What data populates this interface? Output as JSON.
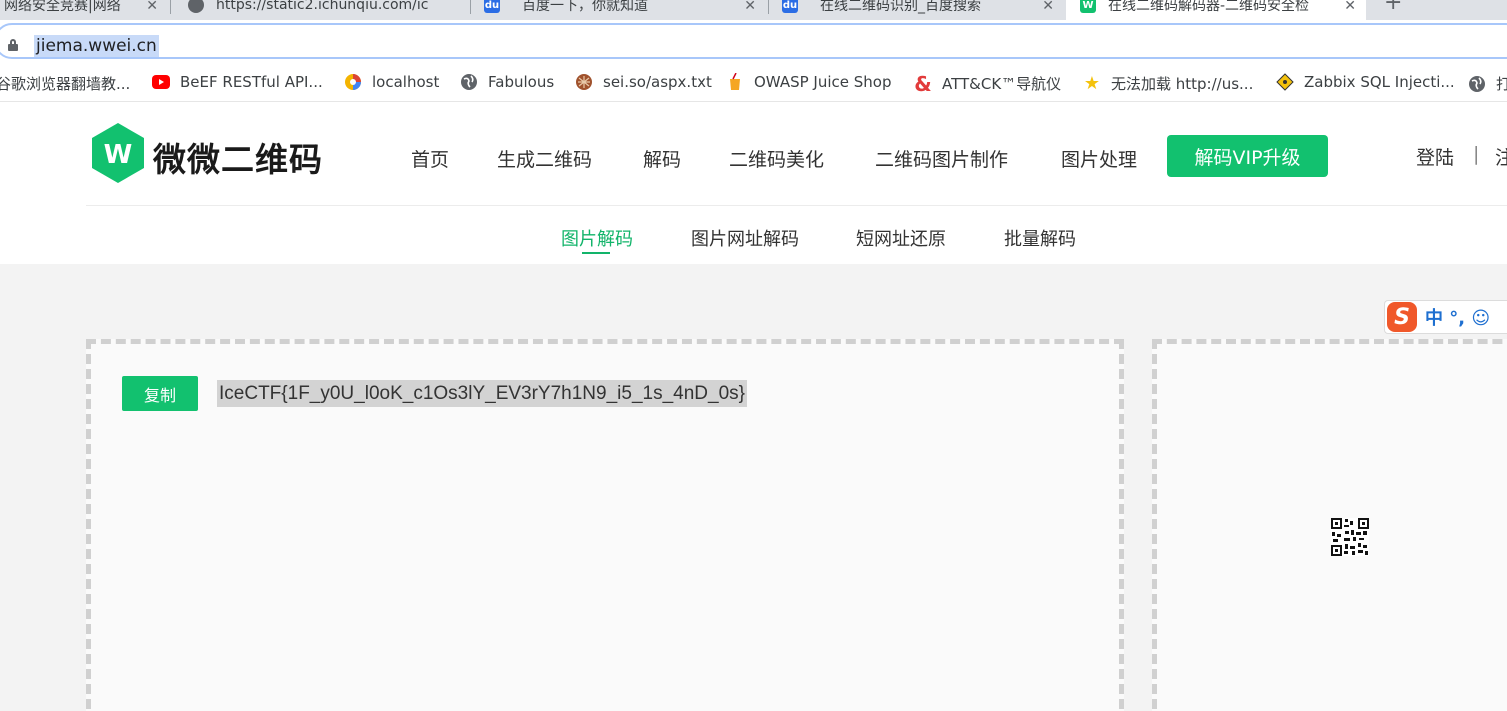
{
  "browser": {
    "tabs": [
      {
        "title": "网络安全竞赛|网络",
        "close": "✕"
      },
      {
        "title": "https://static2.ichunqiu.com/ic",
        "close": "✕"
      },
      {
        "title": "百度一下，你就知道",
        "close": "✕"
      },
      {
        "title": "在线二维码识别_百度搜索",
        "close": "✕"
      },
      {
        "title": "在线二维码解码器-二维码安全检",
        "close": "✕"
      }
    ],
    "new_tab": "+",
    "url": "jiema.wwei.cn",
    "bookmarks": [
      {
        "label": "谷歌浏览器翻墙教...",
        "icon": "folder-icon"
      },
      {
        "label": "BeEF RESTful API...",
        "icon": "youtube-icon"
      },
      {
        "label": "localhost",
        "icon": "localhost-icon"
      },
      {
        "label": "Fabulous",
        "icon": "globe-icon"
      },
      {
        "label": "sei.so/aspx.txt",
        "icon": "shell-icon"
      },
      {
        "label": "OWASP Juice Shop",
        "icon": "juice-icon"
      },
      {
        "label": "ATT&CK™导航仪",
        "icon": "ampersand-icon"
      },
      {
        "label": "无法加载 http://us...",
        "icon": "star-icon"
      },
      {
        "label": "Zabbix SQL Injecti...",
        "icon": "diamond-icon"
      },
      {
        "label": "打",
        "icon": "globe-icon"
      }
    ]
  },
  "site": {
    "logo_text": "微微二维码",
    "logo_letter": "W",
    "nav": [
      "首页",
      "生成二维码",
      "解码",
      "二维码美化",
      "二维码图片制作",
      "图片处理"
    ],
    "vip": "解码VIP升级",
    "login": "登陆",
    "sep": "|",
    "register": "注册",
    "subnav": [
      "图片解码",
      "图片网址解码",
      "短网址还原",
      "批量解码"
    ]
  },
  "main": {
    "copy_label": "复制",
    "result": "IceCTF{1F_y0U_l0oK_c1Os3lY_EV3rY7h1N9_i5_1s_4nD_0s}"
  },
  "ime": {
    "logo": "S",
    "text": "中 °, ☺"
  },
  "colors": {
    "brand_green": "#12c16f",
    "active_green": "#12b46a"
  }
}
